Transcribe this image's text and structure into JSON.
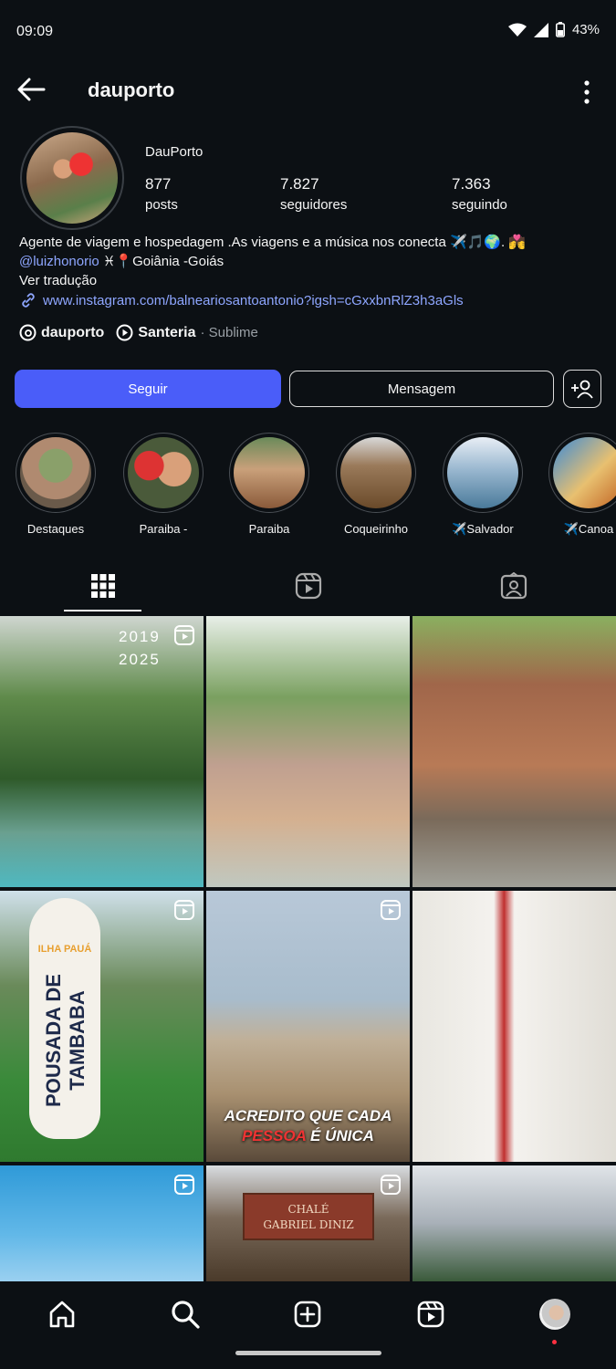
{
  "status_bar": {
    "time": "09:09",
    "battery": "43%"
  },
  "header": {
    "username": "dauporto"
  },
  "profile": {
    "display_name": "DauPorto",
    "stats": [
      {
        "value": "877",
        "label": "posts"
      },
      {
        "value": "7.827",
        "label": "seguidores"
      },
      {
        "value": "7.363",
        "label": "seguindo"
      }
    ],
    "bio_line1": "Agente de viagem e hospedagem .As viagens e a música nos conecta ✈️🎵🌍.   💏",
    "bio_mention": "@luizhonorio",
    "bio_line2_rest": " ♓📍Goiânia -Goiás",
    "translate": "Ver tradução",
    "link": "www.instagram.com/balneariosantoantonio?igsh=cGxxbnRlZ3h3aGls",
    "threads_handle": "dauporto",
    "music_title": "Santeria",
    "music_artist": "· Sublime"
  },
  "actions": {
    "follow": "Seguir",
    "message": "Mensagem"
  },
  "highlights": [
    {
      "label": "Destaques"
    },
    {
      "label": "Paraiba -"
    },
    {
      "label": "Paraiba"
    },
    {
      "label": "Coqueirinho"
    },
    {
      "label": "✈️Salvador"
    },
    {
      "label": "✈️Canoa"
    }
  ],
  "posts": {
    "p1_overlay_line1": "2019",
    "p1_overlay_line2": "2025",
    "p4_board_top": "ILHA PAUÁ",
    "p4_board_main": "POUSADA DE TAMBABA",
    "p5_caption_line1": "ACREDITO QUE CADA",
    "p5_caption_highlight": "PESSOA",
    "p5_caption_rest": " É ÚNICA",
    "p8_sign_line1": "CHALÉ",
    "p8_sign_line2": "GABRIEL DINIZ"
  },
  "colors": {
    "accent": "#4a5df9",
    "background": "#0c1014",
    "link": "#8ea6ff"
  }
}
